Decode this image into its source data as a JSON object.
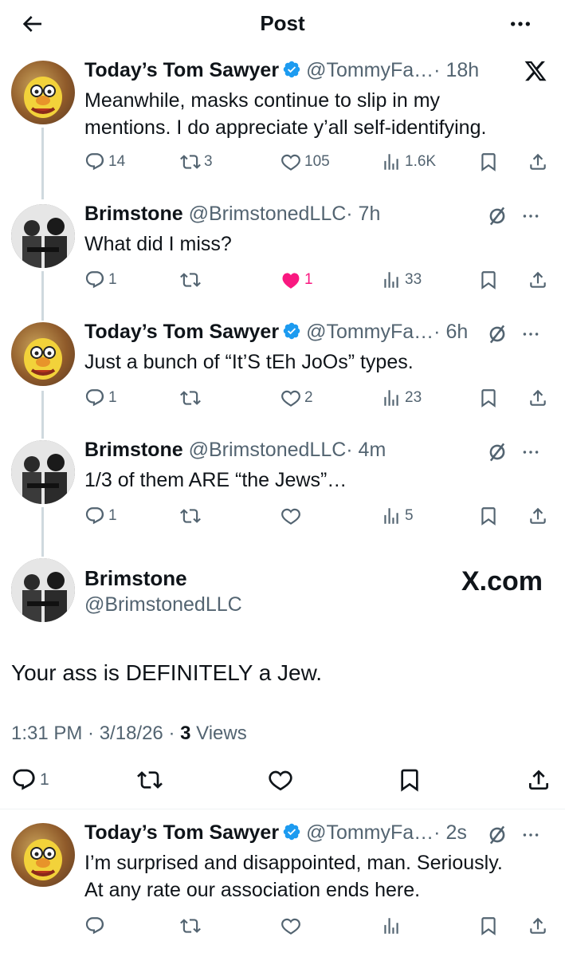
{
  "header": {
    "title": "Post",
    "back_icon": "arrow-left-icon",
    "more_icon": "more-horizontal-icon"
  },
  "colors": {
    "text": "#0f1419",
    "secondary": "#536471",
    "verified": "#1d9bf0",
    "like": "#f91880"
  },
  "tweets": [
    {
      "name": "Today’s Tom Sawyer",
      "handle": "@TommyFa…",
      "time": "· 18h",
      "verified": true,
      "text_lines": [
        "Meanwhile, masks continue to slip in my",
        "mentions. I do appreciate y’all self-identifying."
      ],
      "replies": "14",
      "reposts": "3",
      "likes": "105",
      "views": "1.6K"
    },
    {
      "name": "Brimstone",
      "handle": "@BrimstonedLLC",
      "time": "· 7h",
      "verified": false,
      "text_lines": [
        "What did I miss?"
      ],
      "replies": "1",
      "reposts": "",
      "likes": "1",
      "views": "33"
    },
    {
      "name": "Today’s Tom Sawyer",
      "handle": "@TommyFa…",
      "time": "· 6h",
      "verified": true,
      "text_lines": [
        "Just a bunch of “It’S tEh JoOs” types."
      ],
      "replies": "1",
      "reposts": "",
      "likes": "2",
      "views": "23"
    },
    {
      "name": "Brimstone",
      "handle": "@BrimstonedLLC",
      "time": "· 4m",
      "verified": false,
      "text_lines": [
        "1/3 of them ARE “the Jews”…"
      ],
      "replies": "1",
      "reposts": "",
      "likes": "",
      "views": "5"
    }
  ],
  "main_post": {
    "name": "Brimstone",
    "handle": "@BrimstonedLLC",
    "watermark": "X.com",
    "text": "Your ass is DEFINITELY a Jew.",
    "time": "1:31 PM · 3/18/26 · ",
    "views_count": "3",
    "views_label": " Views",
    "replies": "1"
  },
  "reply": {
    "name": "Today’s Tom Sawyer",
    "handle": "@TommyFa…",
    "time": "· 2s",
    "verified": true,
    "text_lines": [
      "I’m surprised and disappointed, man. Seriously.",
      "At any rate our association ends here."
    ]
  }
}
